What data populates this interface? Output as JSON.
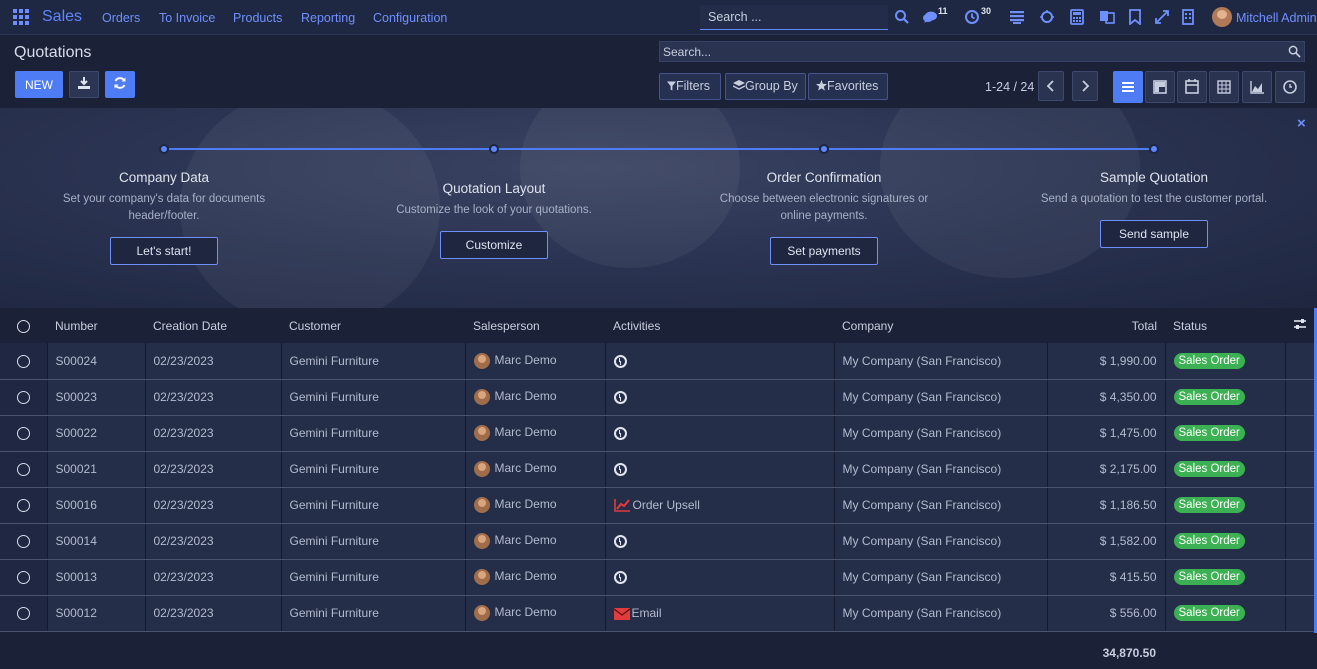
{
  "navbar": {
    "brand": "Sales",
    "menu": [
      "Orders",
      "To Invoice",
      "Products",
      "Reporting",
      "Configuration"
    ],
    "search_placeholder": "Search ...",
    "messages_badge": "11",
    "activities_badge": "30",
    "user_name": "Mitchell Admin"
  },
  "control_panel": {
    "title": "Quotations",
    "new_label": "NEW",
    "search_placeholder": "Search...",
    "filters_label": "Filters",
    "group_by_label": "Group By",
    "favorites_label": "Favorites",
    "pager": "1-24 / 24"
  },
  "onboarding": {
    "steps": [
      {
        "title": "Company Data",
        "desc": "Set your company's data for documents header/footer.",
        "button": "Let's start!"
      },
      {
        "title": "Quotation Layout",
        "desc": "Customize the look of your quotations.",
        "button": "Customize"
      },
      {
        "title": "Order Confirmation",
        "desc": "Choose between electronic signatures or online payments.",
        "button": "Set payments"
      },
      {
        "title": "Sample Quotation",
        "desc": "Send a quotation to test the customer portal.",
        "button": "Send sample"
      }
    ],
    "close_glyph": "×"
  },
  "table": {
    "columns": [
      "Number",
      "Creation Date",
      "Customer",
      "Salesperson",
      "Activities",
      "Company",
      "Total",
      "Status"
    ],
    "rows": [
      {
        "number": "S00024",
        "date": "02/23/2023",
        "customer": "Gemini Furniture",
        "salesperson": "Marc Demo",
        "activity_icon": "clock-icon",
        "activity_text": "",
        "company": "My Company (San Francisco)",
        "total": "$ 1,990.00",
        "status": "Sales Order"
      },
      {
        "number": "S00023",
        "date": "02/23/2023",
        "customer": "Gemini Furniture",
        "salesperson": "Marc Demo",
        "activity_icon": "clock-icon",
        "activity_text": "",
        "company": "My Company (San Francisco)",
        "total": "$ 4,350.00",
        "status": "Sales Order"
      },
      {
        "number": "S00022",
        "date": "02/23/2023",
        "customer": "Gemini Furniture",
        "salesperson": "Marc Demo",
        "activity_icon": "clock-icon",
        "activity_text": "",
        "company": "My Company (San Francisco)",
        "total": "$ 1,475.00",
        "status": "Sales Order"
      },
      {
        "number": "S00021",
        "date": "02/23/2023",
        "customer": "Gemini Furniture",
        "salesperson": "Marc Demo",
        "activity_icon": "clock-icon",
        "activity_text": "",
        "company": "My Company (San Francisco)",
        "total": "$ 2,175.00",
        "status": "Sales Order"
      },
      {
        "number": "S00016",
        "date": "02/23/2023",
        "customer": "Gemini Furniture",
        "salesperson": "Marc Demo",
        "activity_icon": "line-chart-icon",
        "activity_text": "Order Upsell",
        "company": "My Company (San Francisco)",
        "total": "$ 1,186.50",
        "status": "Sales Order"
      },
      {
        "number": "S00014",
        "date": "02/23/2023",
        "customer": "Gemini Furniture",
        "salesperson": "Marc Demo",
        "activity_icon": "clock-icon",
        "activity_text": "",
        "company": "My Company (San Francisco)",
        "total": "$ 1,582.00",
        "status": "Sales Order"
      },
      {
        "number": "S00013",
        "date": "02/23/2023",
        "customer": "Gemini Furniture",
        "salesperson": "Marc Demo",
        "activity_icon": "clock-icon",
        "activity_text": "",
        "company": "My Company (San Francisco)",
        "total": "$ 415.50",
        "status": "Sales Order"
      },
      {
        "number": "S00012",
        "date": "02/23/2023",
        "customer": "Gemini Furniture",
        "salesperson": "Marc Demo",
        "activity_icon": "envelope-icon",
        "activity_text": "Email",
        "company": "My Company (San Francisco)",
        "total": "$ 556.00",
        "status": "Sales Order"
      }
    ],
    "grand_total": "34,870.50"
  },
  "colors": {
    "accent": "#4e7cf5",
    "link": "#6f8fff",
    "status_green": "#3cb153",
    "activity_red": "#e03c3c",
    "background": "#1b2238"
  }
}
